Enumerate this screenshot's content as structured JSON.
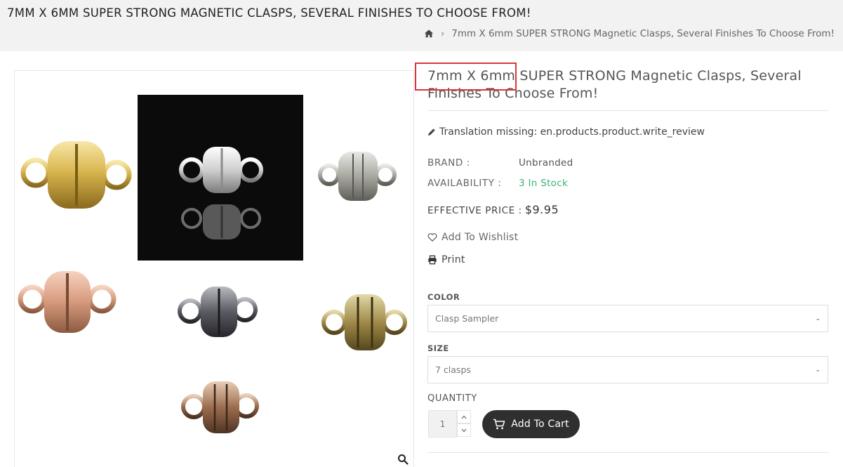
{
  "header": {
    "page_heading": "7MM X 6MM SUPER STRONG MAGNETIC CLASPS, SEVERAL FINISHES TO CHOOSE FROM!",
    "breadcrumb": {
      "home_icon": "home-icon",
      "separator": "›",
      "current": "7mm X 6mm SUPER STRONG Magnetic Clasps, Several Finishes To Choose From!"
    }
  },
  "gallery": {
    "zoom_icon": "search-icon",
    "finishes": [
      "gold",
      "silver",
      "antique-silver",
      "copper",
      "gunmetal",
      "antique-brass",
      "antique-copper"
    ]
  },
  "product": {
    "title": "7mm X 6mm SUPER STRONG Magnetic Clasps, Several Finishes To Choose From!",
    "review_text": "Translation missing: en.products.product.write_review",
    "brand_label": "BRAND :",
    "brand_value": "Unbranded",
    "availability_label": "AVAILABILITY :",
    "availability_value": "3 In Stock",
    "price_label": "EFFECTIVE PRICE :",
    "price_value": "$9.95",
    "wishlist_label": "Add To Wishlist",
    "print_label": "Print",
    "color_label": "COLOR",
    "color_value": "Clasp Sampler",
    "size_label": "SIZE",
    "size_value": "7 clasps",
    "quantity_label": "QUANTITY",
    "quantity_value": "1",
    "add_to_cart_label": "Add To Cart",
    "stock_color": "#3cb371",
    "button_color": "#2f2f2f",
    "highlight_color": "#d9363e"
  }
}
